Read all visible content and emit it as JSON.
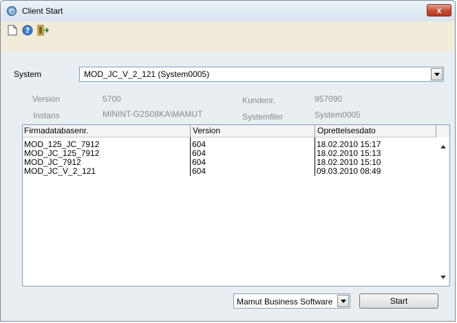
{
  "window": {
    "title": "Client Start",
    "close_label": "x"
  },
  "toolbar": {
    "icons": [
      "new-document-icon",
      "help-icon",
      "exit-icon"
    ]
  },
  "system": {
    "label": "System",
    "selected": "MOD_JC_V_2_121 (System0005)"
  },
  "info": {
    "version_label": "Version",
    "version_value": "5700",
    "customer_label": "Kundenr.",
    "customer_value": "957090",
    "instance_label": "Instans",
    "instance_value": "MININT-G2S08KA\\MAMUT",
    "systemfiles_label": "Systemfiler",
    "systemfiles_value": "System0005"
  },
  "table": {
    "columns": [
      "Firmadatabasenr.",
      "Version",
      "Oprettelsesdato"
    ],
    "rows": [
      {
        "db": "MOD_125_JC_7912",
        "version": "604",
        "created": "18.02.2010 15:17"
      },
      {
        "db": "MOD_JC_125_7912",
        "version": "604",
        "created": "18.02.2010 15:13"
      },
      {
        "db": "MOD_JC_7912",
        "version": "604",
        "created": "18.02.2010 15:10"
      },
      {
        "db": "MOD_JC_V_2_121",
        "version": "604",
        "created": "09.03.2010 08:49"
      }
    ]
  },
  "footer": {
    "product_selected": "Mamut Business Software",
    "start_label": "Start"
  }
}
